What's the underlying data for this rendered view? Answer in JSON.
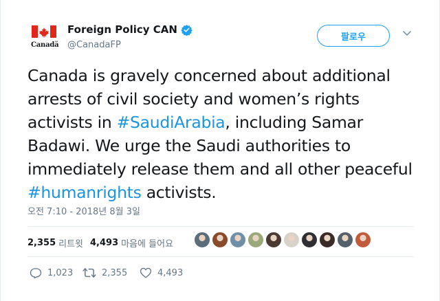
{
  "author": {
    "display_name": "Foreign Policy CAN",
    "handle": "@CanadaFP",
    "logo_wordmark": "Canadä",
    "verified": true
  },
  "follow_button": {
    "label": "팔로우"
  },
  "tweet": {
    "text_parts": [
      {
        "type": "text",
        "value": "Canada is gravely concerned about additional arrests of civil society and women’s rights activists in "
      },
      {
        "type": "hashtag",
        "value": "#SaudiArabia"
      },
      {
        "type": "text",
        "value": ", including Samar Badawi. We urge the Saudi authorities to immediately release them and all other peaceful "
      },
      {
        "type": "hashtag",
        "value": "#humanrights"
      },
      {
        "type": "text",
        "value": " activists."
      }
    ],
    "timestamp": "오전 7:10 - 2018년 8월 3일"
  },
  "stats": {
    "retweets_count": "2,355",
    "retweets_label": "리트윗",
    "likes_count": "4,493",
    "likes_label": "마음에 들어요"
  },
  "likers": [
    {
      "name": "liker-1",
      "color": "#5b6e7a"
    },
    {
      "name": "liker-2",
      "color": "#8a4b2a"
    },
    {
      "name": "liker-3",
      "color": "#6f8fa8"
    },
    {
      "name": "liker-4",
      "color": "#9aa87a"
    },
    {
      "name": "liker-5",
      "color": "#4a3a32"
    },
    {
      "name": "liker-6",
      "color": "#d8d2c8"
    },
    {
      "name": "liker-7",
      "color": "#2f2f33"
    },
    {
      "name": "liker-8",
      "color": "#3a2a28"
    },
    {
      "name": "liker-9",
      "color": "#56606a"
    },
    {
      "name": "liker-10",
      "color": "#c25a3c"
    }
  ],
  "actions": {
    "replies": "1,023",
    "retweets": "2,355",
    "likes": "4,493"
  },
  "colors": {
    "accent": "#1da1f2",
    "link": "#1b95e0",
    "secondary_text": "#657786",
    "canada_red": "#e1261c"
  }
}
